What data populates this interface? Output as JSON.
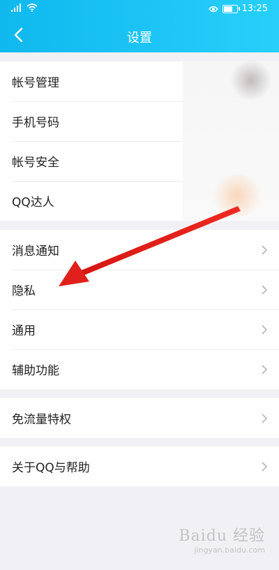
{
  "status_bar": {
    "time": "13:25",
    "battery_level_percent": 80
  },
  "header": {
    "title": "设置"
  },
  "groups": [
    {
      "items": [
        {
          "label": "帐号管理"
        },
        {
          "label": "手机号码"
        },
        {
          "label": "帐号安全"
        },
        {
          "label": "QQ达人"
        }
      ]
    },
    {
      "items": [
        {
          "label": "消息通知"
        },
        {
          "label": "隐私"
        },
        {
          "label": "通用"
        },
        {
          "label": "辅助功能"
        }
      ]
    },
    {
      "items": [
        {
          "label": "免流量特权"
        }
      ]
    },
    {
      "items": [
        {
          "label": "关于QQ与帮助"
        }
      ]
    }
  ],
  "watermark": {
    "text": "Baidu 经验",
    "sub": "jingyan.baidu.com"
  },
  "colors": {
    "header_start": "#0fb8ee",
    "header_end": "#27d0fb",
    "arrow": "#e0201b",
    "background": "#f1f1f5"
  }
}
